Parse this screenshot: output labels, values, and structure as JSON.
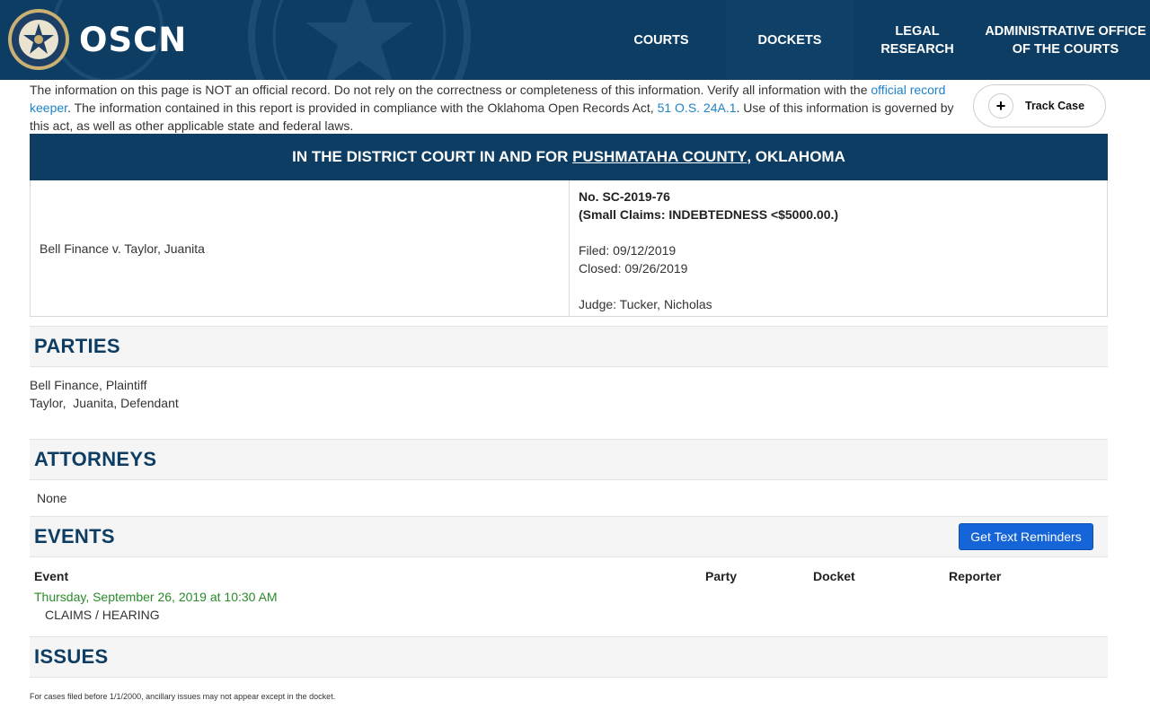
{
  "header": {
    "brand": "OSCN",
    "nav": [
      {
        "label": "COURTS"
      },
      {
        "label": "DOCKETS"
      },
      {
        "label_line1": "LEGAL",
        "label_line2": "RESEARCH"
      },
      {
        "label_line1": "ADMINISTRATIVE OFFICE",
        "label_line2": "OF THE COURTS"
      }
    ]
  },
  "disclaimer": {
    "part1": "The information on this page is NOT an official record. Do not rely on the correctness or completeness of this information. Verify all information with the ",
    "link1": "official record keeper",
    "part2": ". The information contained in this report is provided in compliance with the Oklahoma Open Records Act, ",
    "link2": "51 O.S. 24A.1",
    "part3": ". Use of this information is governed by this act, as well as other applicable state and federal laws."
  },
  "track_case": {
    "icon": "plus-icon",
    "label": "Track Case"
  },
  "court": {
    "prefix": "IN THE DISTRICT COURT IN AND FOR ",
    "county": "PUSHMATAHA COUNTY",
    "suffix": ", OKLAHOMA"
  },
  "case": {
    "style": "Bell Finance v. Taylor, Juanita",
    "number": "No. SC-2019-76",
    "type": "(Small Claims: INDEBTEDNESS <$5000.00.)",
    "filed": "Filed: 09/12/2019",
    "closed": "Closed: 09/26/2019",
    "judge": "Judge: Tucker, Nicholas"
  },
  "sections": {
    "parties": "PARTIES",
    "attorneys": "ATTORNEYS",
    "events": "EVENTS",
    "issues": "ISSUES"
  },
  "parties": [
    "Bell Finance, Plaintiff",
    "Taylor,  Juanita, Defendant"
  ],
  "attorneys_text": "None",
  "events": {
    "button": "Get Text Reminders",
    "columns": {
      "event": "Event",
      "party": "Party",
      "docket": "Docket",
      "reporter": "Reporter"
    },
    "items": [
      {
        "date": "Thursday, September 26, 2019 at 10:30 AM",
        "description": "CLAIMS / HEARING"
      }
    ]
  },
  "footnote": "For cases filed before 1/1/2000, ancillary issues may not appear except in the docket.",
  "colors": {
    "navy": "#0e3d63",
    "link": "#1e82c8",
    "button": "#1565d8",
    "event_date": "#2a8a2a"
  }
}
